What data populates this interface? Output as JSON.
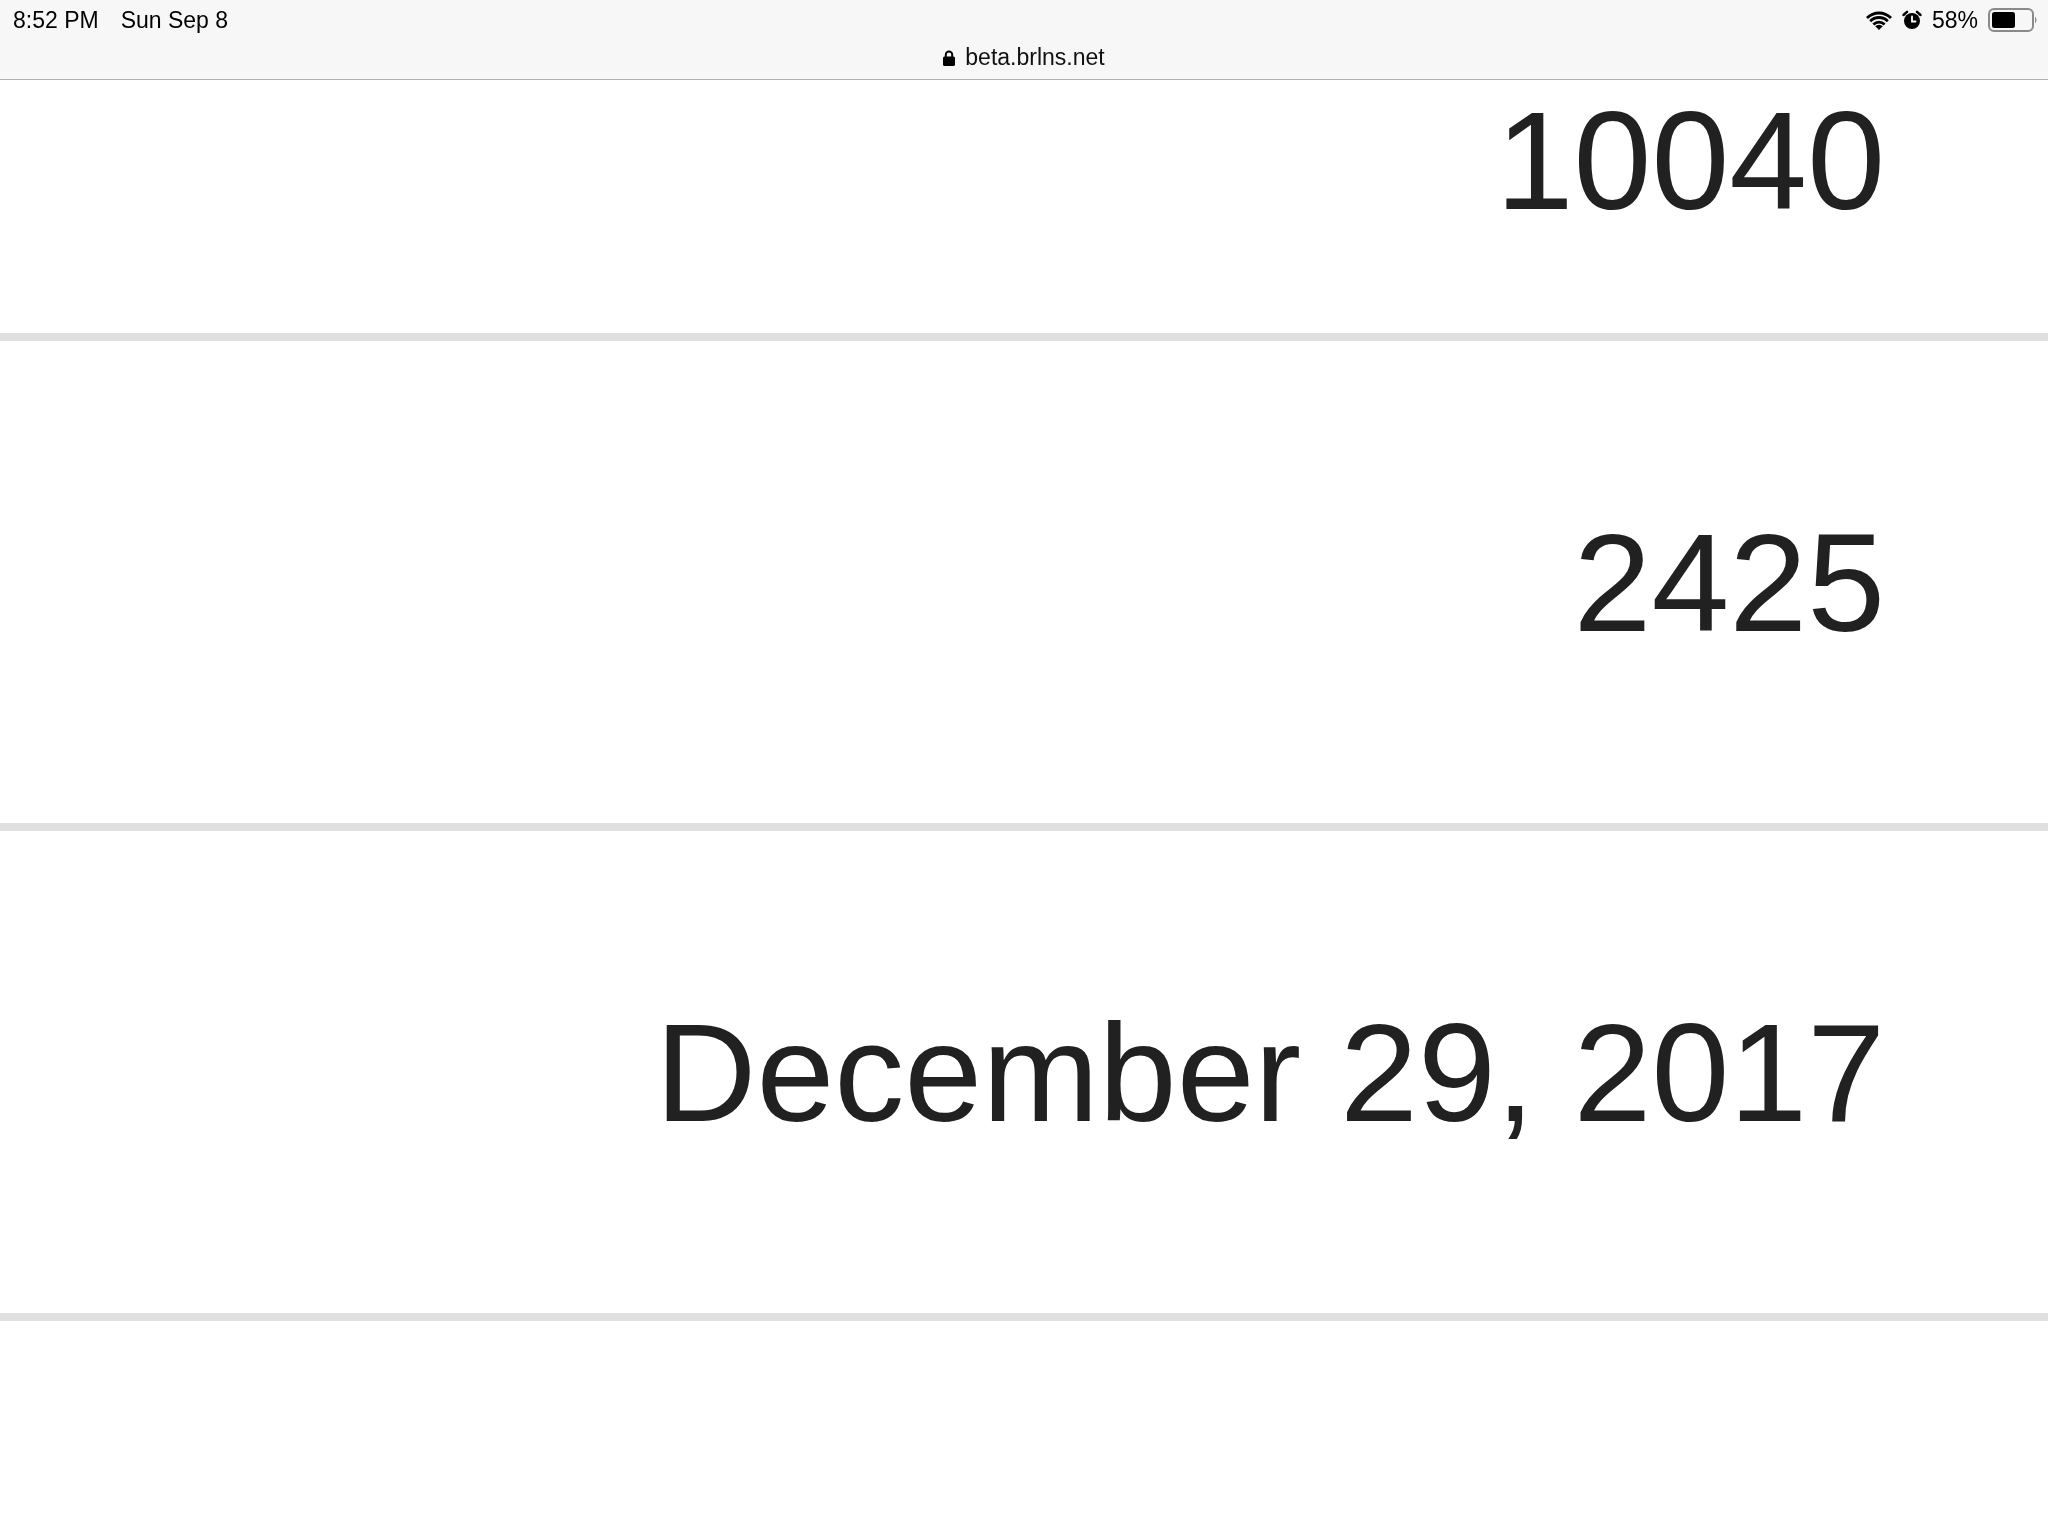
{
  "status_bar": {
    "time": "8:52 PM",
    "date": "Sun Sep 8",
    "battery_text": "58%"
  },
  "address_bar": {
    "secure": true,
    "url": "beta.brlns.net"
  },
  "rows": [
    {
      "value": "10040"
    },
    {
      "value": "2425"
    },
    {
      "value": "December 29, 2017"
    }
  ]
}
